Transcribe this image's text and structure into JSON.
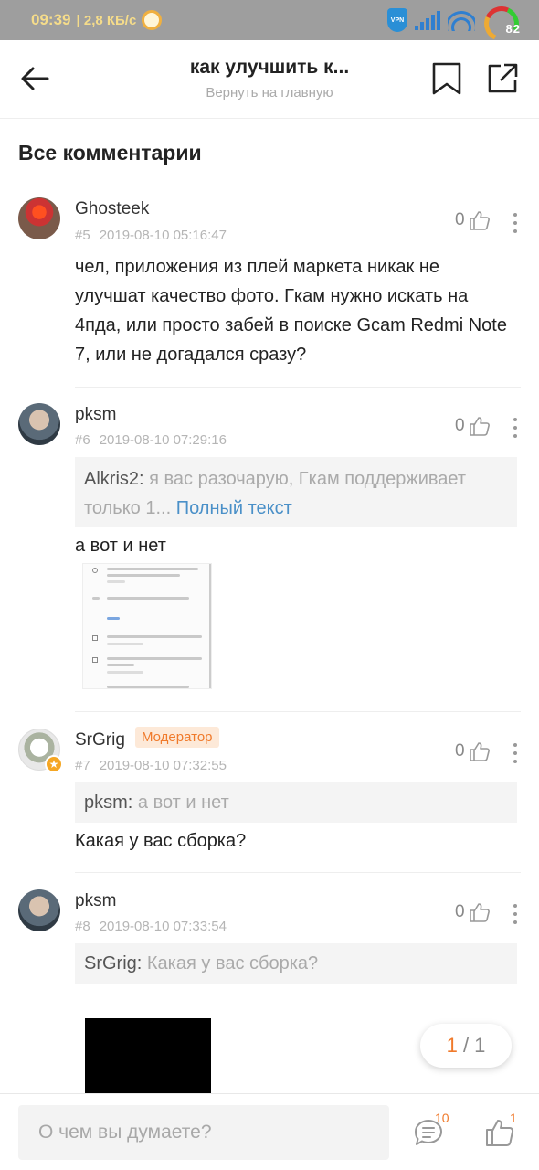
{
  "status_bar": {
    "time": "09:39",
    "speed": "| 2,8 КБ/с",
    "vpn_label": "VPN",
    "battery": "82"
  },
  "header": {
    "title": "как улучшить к...",
    "subtitle": "Вернуть на главную"
  },
  "section_title": "Все комментарии",
  "comments": [
    {
      "author": "Ghosteek",
      "number": "#5",
      "datetime": "2019-08-10 05:16:47",
      "likes": "0",
      "text": "чел, приложения из плей маркета никак не улучшат качество фото. Гкам нужно искать на 4пда, или просто забей в поиске Gcam Redmi Note 7, или не догадался сразу?"
    },
    {
      "author": "pksm",
      "number": "#6",
      "datetime": "2019-08-10 07:29:16",
      "likes": "0",
      "quote_author": "Alkris2:",
      "quote_text": " я вас разочарую, Гкам поддерживает только 1... ",
      "quote_more": "Полный текст",
      "text": "а вот и нет"
    },
    {
      "author": "SrGrig",
      "badge": "Модератор",
      "number": "#7",
      "datetime": "2019-08-10 07:32:55",
      "likes": "0",
      "quote_author": "pksm:",
      "quote_text": " а вот и нет",
      "text": "Какая у вас сборка?"
    },
    {
      "author": "pksm",
      "number": "#8",
      "datetime": "2019-08-10 07:33:54",
      "likes": "0",
      "quote_author": "SrGrig:",
      "quote_text": " Какая у вас сборка?"
    }
  ],
  "pager": {
    "current": "1",
    "separator": " / ",
    "total": "1"
  },
  "bottom_bar": {
    "input_placeholder": "О чем вы думаете?",
    "comment_count": "10",
    "like_count": "1"
  }
}
